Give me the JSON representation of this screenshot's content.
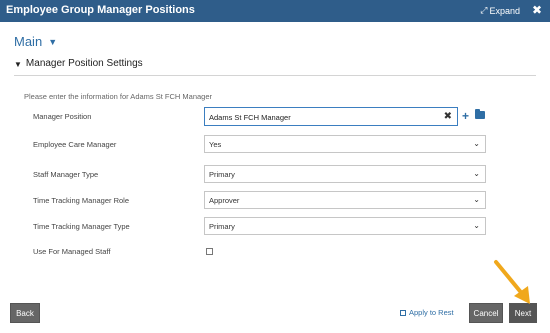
{
  "window": {
    "title": "Employee Group Manager Positions",
    "expand_label": "Expand",
    "expand_icon": "expand-icon",
    "close_icon": "close-icon"
  },
  "menu": {
    "main_label": "Main"
  },
  "section": {
    "title": "Manager Position Settings"
  },
  "instruction": "Please enter the information for Adams St FCH Manager",
  "fields": {
    "manager_position": {
      "label": "Manager Position",
      "value": "Adams St FCH Manager"
    },
    "employee_care_manager": {
      "label": "Employee Care Manager",
      "value": "Yes"
    },
    "staff_manager_type": {
      "label": "Staff Manager Type",
      "value": "Primary"
    },
    "time_tracking_manager_role": {
      "label": "Time Tracking Manager Role",
      "value": "Approver"
    },
    "time_tracking_manager_type": {
      "label": "Time Tracking Manager Type",
      "value": "Primary"
    },
    "use_for_managed_staff": {
      "label": "Use For Managed Staff",
      "checked": false
    }
  },
  "footer": {
    "back_label": "Back",
    "apply_to_rest_label": "Apply to Rest",
    "cancel_label": "Cancel",
    "next_label": "Next"
  },
  "colors": {
    "titlebar": "#2f5d8a",
    "accent": "#2f6ea5",
    "button": "#666666",
    "arrow": "#f0a81c"
  }
}
